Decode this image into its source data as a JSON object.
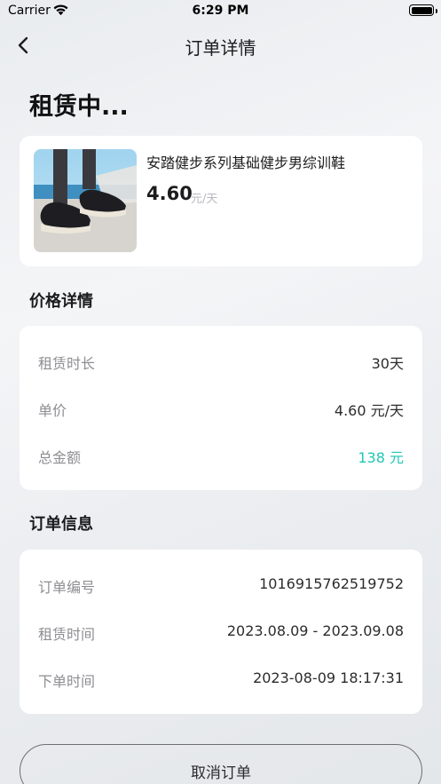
{
  "status_bar": {
    "carrier": "Carrier",
    "time": "6:29 PM"
  },
  "nav": {
    "title": "订单详情"
  },
  "order_status": "租赁中...",
  "product": {
    "name": "安踏健步系列基础健步男综训鞋",
    "price": "4.60",
    "unit": "元/天"
  },
  "price_section": {
    "title": "价格详情",
    "rows": [
      {
        "label": "租赁时长",
        "value": "30天"
      },
      {
        "label": "单价",
        "value": "4.60 元/天"
      },
      {
        "label": "总金额",
        "value": "138 元"
      }
    ]
  },
  "order_section": {
    "title": "订单信息",
    "rows": [
      {
        "label": "订单编号",
        "value": "1016915762519752"
      },
      {
        "label": "租赁时间",
        "value": "2023.08.09 - 2023.09.08"
      },
      {
        "label": "下单时间",
        "value": "2023-08-09 18:17:31"
      }
    ]
  },
  "actions": {
    "cancel_label": "取消订单"
  },
  "colors": {
    "accent": "#1fc7b6"
  }
}
